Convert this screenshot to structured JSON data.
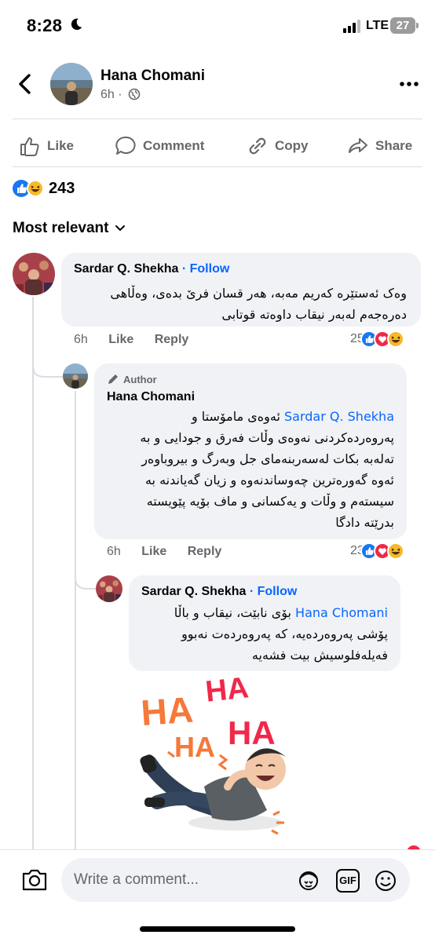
{
  "status": {
    "time": "8:28",
    "network": "LTE",
    "battery": "27"
  },
  "post": {
    "author": "Hana Chomani",
    "age": "6h",
    "reaction_count": "243"
  },
  "actions": {
    "like": "Like",
    "comment": "Comment",
    "copy": "Copy",
    "share": "Share"
  },
  "sort_label": "Most relevant",
  "comments": [
    {
      "author": "Sardar Q. Shekha",
      "follow": "Follow",
      "lines": [
        "وەک ئەستێرە کەریم مەبە، هەر قسان فرێ بدەی، وەڵاهی",
        "دەرەجەم لەبەر نیقاب داوەتە قوتابی"
      ],
      "age": "6h",
      "like": "Like",
      "reply": "Reply",
      "reactions": "25"
    },
    {
      "badge": "Author",
      "author": "Hana Chomani",
      "mention": "Sardar Q. Shekha",
      "first_line_rest": "ئەوەی مامۆستا و",
      "lines": [
        "پەروەردەکردنی نەوەی وڵات فەرق و جودایی و بە",
        "تەلەبە بکات لەسەربنەمای جل وبەرگ و بیروباوەر",
        "ئەوە گەورەترین چەوساندنەوە و زیان گەیاندنە بە",
        "سیستەم و وڵات و یەکسانی و ماف بۆیە پێویستە",
        "بدرێتە دادگا"
      ],
      "age": "6h",
      "like": "Like",
      "reply": "Reply",
      "reactions": "23"
    },
    {
      "author": "Sardar Q. Shekha",
      "follow": "Follow",
      "mention": "Hana Chomani",
      "first_line_rest": "بۆی نابێت، نیقاب و باڵا",
      "lines": [
        "پۆشی پەروەردەیە، کە پەروەردەت نەبوو",
        "فەیلەفلوسیش بیت فشەیە"
      ],
      "sticker_text": [
        "HA",
        "HA",
        "HA",
        "HA"
      ]
    }
  ],
  "composer": {
    "placeholder": "Write a comment...",
    "gif": "GIF"
  },
  "colors": {
    "accent": "#0866ff",
    "like_blue": "#1877f2",
    "love_red": "#f02849",
    "haha_yellow": "#f7b928",
    "muted": "#65676b"
  }
}
